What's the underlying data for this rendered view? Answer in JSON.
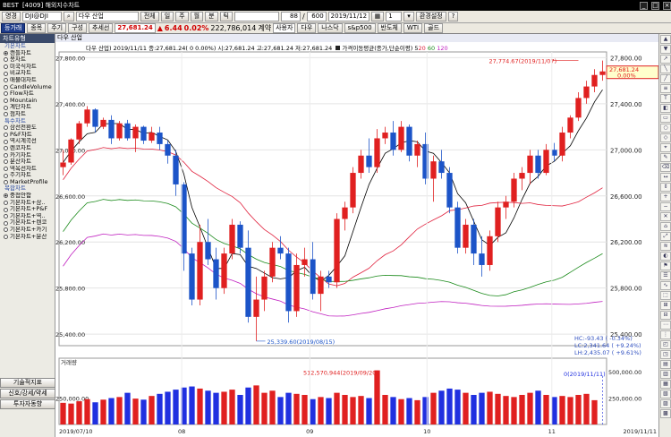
{
  "titlebar": {
    "app": "BEST",
    "title": "[4009] 해외지수차트"
  },
  "toolbar": {
    "kind": "영경",
    "code": "DJI@DJI",
    "name": "다우 산업",
    "range": "전체",
    "periods": [
      "일",
      "주",
      "월",
      "분",
      "틱"
    ],
    "count": "88",
    "total": "600",
    "date": "2019/11/12",
    "step": "1",
    "settings": "환경설정"
  },
  "toolbar2": {
    "label": "등가래",
    "tabs": [
      "종목",
      "주기",
      "구성",
      "추세선"
    ],
    "price": "27,681.24",
    "change": "6.44",
    "change_pct": "0.02%",
    "volume": "222,786,014",
    "vol_label": "계약",
    "user": "사용자",
    "index_buttons": [
      "다우",
      "나스닥",
      "s&p500",
      "반도체",
      "WTI",
      "골드"
    ]
  },
  "sidebar": {
    "header": "차트유형",
    "sections": [
      {
        "title": "기본차트",
        "items": [
          "캔들차트",
          "봉차트",
          "미국식차트",
          "비교차트",
          "매물대차트",
          "CandleVolume",
          "Flow차트",
          "Mountain",
          "계단차트",
          "점차트"
        ]
      },
      {
        "title": "특수차트",
        "items": [
          "삼선전환도",
          "P&F차트",
          "역시계곡선",
          "렌코차트",
          "카기차트",
          "분산차트",
          "역옥선차트",
          "주기차트",
          "MarketProfile"
        ]
      },
      {
        "title": "복합차트",
        "items": [
          "중첩안함",
          "기본차트+삼..",
          "기본차트+P&F",
          "기본차트+역..",
          "기본차트+렌코",
          "기본차트+카기",
          "기본차트+분산"
        ]
      }
    ],
    "selected": [
      "캔들차트",
      "중첩안함"
    ],
    "bottom_buttons": [
      "기술적지표",
      "신호/강세/약세",
      "투자자동향"
    ]
  },
  "chart_header": {
    "title": "다우 산업"
  },
  "legend": {
    "ohlc": "다우 산업) 2019/11/11 종:27,681.24( 0 0.00%) 시:27,681.24 고:27,681.24 저:27,681.24",
    "ma_title": "가격이동평균(종가,단순이평)",
    "ma_periods": [
      "5",
      "20",
      "60",
      "120"
    ],
    "ma_colors": [
      "#000000",
      "#e0203c",
      "#1a8a1a",
      "#c020c0"
    ]
  },
  "annotations": {
    "high": "27,774.67(2019/11/07)",
    "low": "25,339.60(2019/08/15)",
    "last_price": "27,681.24",
    "last_pct": "0.00%",
    "hc": "HC:-93.43 ( -0.34%)",
    "lc": "LC:2,341.64 ( +9.24%)",
    "lh": "LH:2,435.07 ( +9.61%)",
    "vol_title": "거래량",
    "vol_max": "512,570,944(2019/09/20)",
    "vol_last": "0(2019/11/11)"
  },
  "y_labels": [
    "27,800.00",
    "27,400.00",
    "27,000.00",
    "26,600.00",
    "26,200.00",
    "25,800.00",
    "25,400.00"
  ],
  "vol_labels": [
    "500,000.00",
    "250,000.00"
  ],
  "vol_left_label": "250,000.00",
  "x_labels": [
    "2019/07/10",
    "08",
    "09",
    "10",
    "11",
    "2019/11/11"
  ],
  "chart_data": {
    "type": "candlestick",
    "x_range": [
      "2019/07/10",
      "2019/11/11"
    ],
    "ylim": [
      25300,
      27850
    ],
    "high_point": {
      "value": 27774.67,
      "date": "2019/11/07"
    },
    "low_point": {
      "value": 25339.6,
      "date": "2019/08/15"
    },
    "last": 27681.24,
    "ohlc": [
      [
        26850,
        27000,
        26780,
        26890
      ],
      [
        26890,
        27100,
        26870,
        27090
      ],
      [
        27090,
        27250,
        27050,
        27230
      ],
      [
        27230,
        27380,
        27200,
        27350
      ],
      [
        27350,
        27360,
        27150,
        27200
      ],
      [
        27200,
        27280,
        27180,
        27260
      ],
      [
        27260,
        27300,
        27050,
        27100
      ],
      [
        27100,
        27250,
        27080,
        27230
      ],
      [
        27230,
        27260,
        27080,
        27100
      ],
      [
        27100,
        27220,
        26980,
        27200
      ],
      [
        27200,
        27210,
        27050,
        27080
      ],
      [
        27080,
        27200,
        27060,
        27150
      ],
      [
        27150,
        27200,
        27000,
        27050
      ],
      [
        27050,
        27080,
        26880,
        26950
      ],
      [
        26950,
        27000,
        26600,
        26700
      ],
      [
        26700,
        26720,
        25950,
        26100
      ],
      [
        26100,
        26150,
        25650,
        25700
      ],
      [
        25700,
        26350,
        25650,
        26200
      ],
      [
        26200,
        26400,
        26000,
        26050
      ],
      [
        26050,
        26150,
        25700,
        25800
      ],
      [
        25800,
        26150,
        25750,
        26100
      ],
      [
        26100,
        26400,
        26050,
        26350
      ],
      [
        26350,
        26380,
        26100,
        26150
      ],
      [
        26150,
        26300,
        25500,
        25550
      ],
      [
        25550,
        25900,
        25340,
        25700
      ],
      [
        25700,
        25950,
        25600,
        25900
      ],
      [
        25900,
        26200,
        25850,
        26150
      ],
      [
        26150,
        26250,
        26050,
        26100
      ],
      [
        26100,
        26150,
        25500,
        25600
      ],
      [
        25600,
        26100,
        25550,
        26000
      ],
      [
        26000,
        26150,
        25900,
        26050
      ],
      [
        26050,
        26200,
        25700,
        25750
      ],
      [
        25750,
        25950,
        25600,
        25900
      ],
      [
        25900,
        25950,
        25800,
        25850
      ],
      [
        25850,
        26450,
        25800,
        26400
      ],
      [
        26400,
        26550,
        26300,
        26500
      ],
      [
        26500,
        26850,
        26450,
        26800
      ],
      [
        26800,
        27000,
        26750,
        26950
      ],
      [
        26950,
        27100,
        26800,
        26850
      ],
      [
        26850,
        27180,
        26800,
        27100
      ],
      [
        27100,
        27200,
        27050,
        27150
      ],
      [
        27150,
        27250,
        26950,
        27000
      ],
      [
        27000,
        27250,
        26980,
        27200
      ],
      [
        27200,
        27220,
        26900,
        26950
      ],
      [
        26950,
        27080,
        26850,
        27050
      ],
      [
        27050,
        27150,
        26700,
        26750
      ],
      [
        26750,
        26950,
        26550,
        26900
      ],
      [
        26900,
        27000,
        26750,
        26800
      ],
      [
        26800,
        26850,
        26450,
        26500
      ],
      [
        26500,
        26550,
        26100,
        26150
      ],
      [
        26150,
        26400,
        26100,
        26350
      ],
      [
        26350,
        26400,
        26000,
        26100
      ],
      [
        26100,
        26250,
        25900,
        26000
      ],
      [
        26000,
        26300,
        25950,
        26250
      ],
      [
        26250,
        26550,
        26200,
        26500
      ],
      [
        26500,
        26600,
        26400,
        26550
      ],
      [
        26550,
        26800,
        26500,
        26750
      ],
      [
        26750,
        26850,
        26650,
        26800
      ],
      [
        26800,
        27000,
        26700,
        26950
      ],
      [
        26950,
        27000,
        26750,
        26800
      ],
      [
        26800,
        27050,
        26780,
        27000
      ],
      [
        27000,
        27060,
        26900,
        26950
      ],
      [
        26950,
        27200,
        26900,
        27150
      ],
      [
        27150,
        27300,
        27100,
        27280
      ],
      [
        27280,
        27500,
        27250,
        27450
      ],
      [
        27450,
        27600,
        27400,
        27550
      ],
      [
        27550,
        27700,
        27500,
        27650
      ],
      [
        27650,
        27775,
        27600,
        27681
      ]
    ],
    "volume": [
      205000000,
      198000000,
      220000000,
      240000000,
      210000000,
      235000000,
      250000000,
      260000000,
      300000000,
      245000000,
      235000000,
      270000000,
      290000000,
      310000000,
      330000000,
      350000000,
      360000000,
      340000000,
      320000000,
      300000000,
      310000000,
      330000000,
      280000000,
      350000000,
      370000000,
      300000000,
      320000000,
      260000000,
      300000000,
      290000000,
      280000000,
      240000000,
      260000000,
      250000000,
      300000000,
      280000000,
      260000000,
      270000000,
      250000000,
      512570944,
      280000000,
      260000000,
      240000000,
      250000000,
      230000000,
      260000000,
      300000000,
      320000000,
      340000000,
      330000000,
      300000000,
      280000000,
      300000000,
      310000000,
      290000000,
      270000000,
      260000000,
      280000000,
      300000000,
      320000000,
      280000000,
      260000000,
      270000000,
      260000000,
      280000000,
      290000000,
      230000000,
      0
    ]
  }
}
